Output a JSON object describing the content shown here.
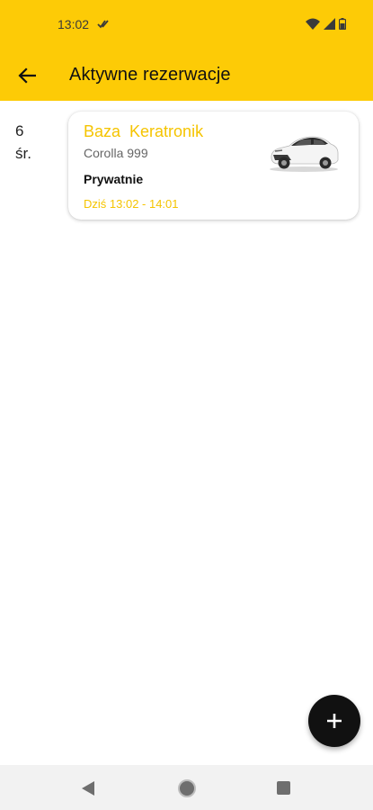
{
  "status_bar": {
    "time": "13:02",
    "icons": [
      "check-icon",
      "wifi-icon",
      "signal-icon",
      "battery-icon"
    ]
  },
  "app_bar": {
    "title": "Aktywne rezerwacje",
    "back_icon": "arrow-left-icon"
  },
  "date": {
    "day": "6",
    "weekday": "śr."
  },
  "reservations": [
    {
      "title": "Baza  Keratronik",
      "car": "Corolla 999",
      "type": "Prywatnie",
      "time": "Dziś 13:02 - 14:01",
      "image": "white-toyota-corolla-car"
    }
  ],
  "fab": {
    "icon": "plus-icon"
  },
  "nav_bar": {
    "icons": [
      "nav-back-icon",
      "nav-home-icon",
      "nav-recents-icon"
    ]
  },
  "colors": {
    "accent": "#FDCB06",
    "accent_text": "#F5C400",
    "fab": "#111111",
    "nav_bar": "#f2f2f2"
  }
}
